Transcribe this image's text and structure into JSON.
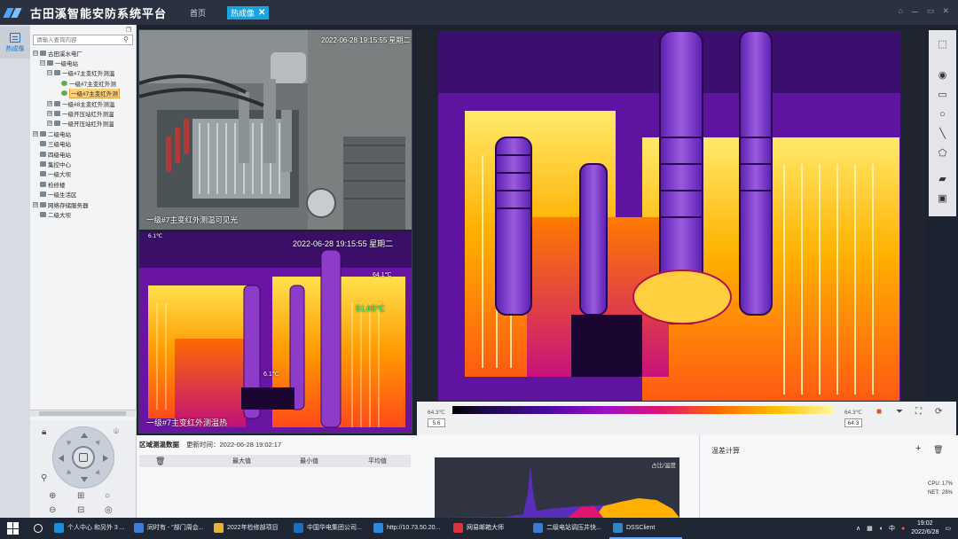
{
  "app": {
    "title": "古田溪智能安防系统平台",
    "nav_home": "首页",
    "nav_tab": "热成像",
    "close_glyph": "✕",
    "win_controls": [
      "⌂",
      "ー",
      "▭",
      "✕"
    ]
  },
  "rail": {
    "label": "热成像"
  },
  "tree": {
    "search_placeholder": "请输入查询内容",
    "nodes": [
      {
        "label": "古田溪水电厂",
        "toggle": "⊟"
      },
      {
        "label": "一级电站",
        "toggle": "⊟"
      },
      {
        "label": "一级#7主变红外测温",
        "toggle": "⊟"
      },
      {
        "label": "一级#7主变红外测",
        "toggle": ""
      },
      {
        "label": "一级#7主变红外测",
        "toggle": ""
      },
      {
        "label": "一级#8主变红外测温",
        "toggle": "⊞"
      },
      {
        "label": "一级开压站红外测温",
        "toggle": "⊞"
      },
      {
        "label": "一级开压站红外测温",
        "toggle": "⊞"
      },
      {
        "label": "二级电站",
        "toggle": "⊞"
      },
      {
        "label": "三级电站",
        "toggle": ""
      },
      {
        "label": "四级电站",
        "toggle": ""
      },
      {
        "label": "集控中心",
        "toggle": ""
      },
      {
        "label": "一级大坝",
        "toggle": ""
      },
      {
        "label": "检修楼",
        "toggle": ""
      },
      {
        "label": "一级生活区",
        "toggle": ""
      },
      {
        "label": "网络存储服务器",
        "toggle": "⊞"
      },
      {
        "label": "二级大坝",
        "toggle": ""
      }
    ]
  },
  "video1": {
    "timestamp": "2022-06-28 19:15:55 星期二",
    "caption": "一级#7主变红外测温可见光"
  },
  "video2": {
    "timestamp": "2022-06-28 19:15:55 星期二",
    "caption": "一级#7主变红外测温热",
    "min_label": "6.1℃",
    "max_label": "64.1℃",
    "spot_label": "51.65℃",
    "low_spot": "6.1℃"
  },
  "palette": {
    "left_temp": "64.3℃",
    "left_val": "5.6",
    "right_temp": "64.3℃",
    "right_val": "64.3"
  },
  "region": {
    "title": "区域测温数据",
    "time_label": "更新时间：2022-06-28 19:02:17",
    "cols": [
      "最大值",
      "最小值",
      "平均值"
    ]
  },
  "histogram": {
    "label": "占比/温度"
  },
  "diff": {
    "title": "温差计算",
    "add": "+"
  },
  "system": {
    "cpu_label": "CPU:",
    "cpu_value": "17%",
    "net_label": "NET:",
    "net_value": "28%"
  },
  "taskbar": {
    "tasks": [
      {
        "label": "个人中心 和另外 3 ...",
        "color": "#1a8fe0"
      },
      {
        "label": "同时有 - \"部门周会...",
        "color": "#3b7dd8"
      },
      {
        "label": "2022年检修部项目",
        "color": "#e8b23a"
      },
      {
        "label": "中国华电集团公司...",
        "color": "#1a6fc4"
      },
      {
        "label": "http://10.73.50.20...",
        "color": "#2b8ae0"
      },
      {
        "label": "网易邮箱大师",
        "color": "#d9333f"
      },
      {
        "label": "二级电站调压井快...",
        "color": "#3a7bd5"
      },
      {
        "label": "DSSClient",
        "color": "#2f86c9"
      }
    ],
    "ime": "中",
    "time": "19:02",
    "date": "2022/6/28"
  },
  "colors": {
    "accent": "#19a3e0",
    "titlebar": "#2b3140",
    "selected": "#ffd27a"
  }
}
